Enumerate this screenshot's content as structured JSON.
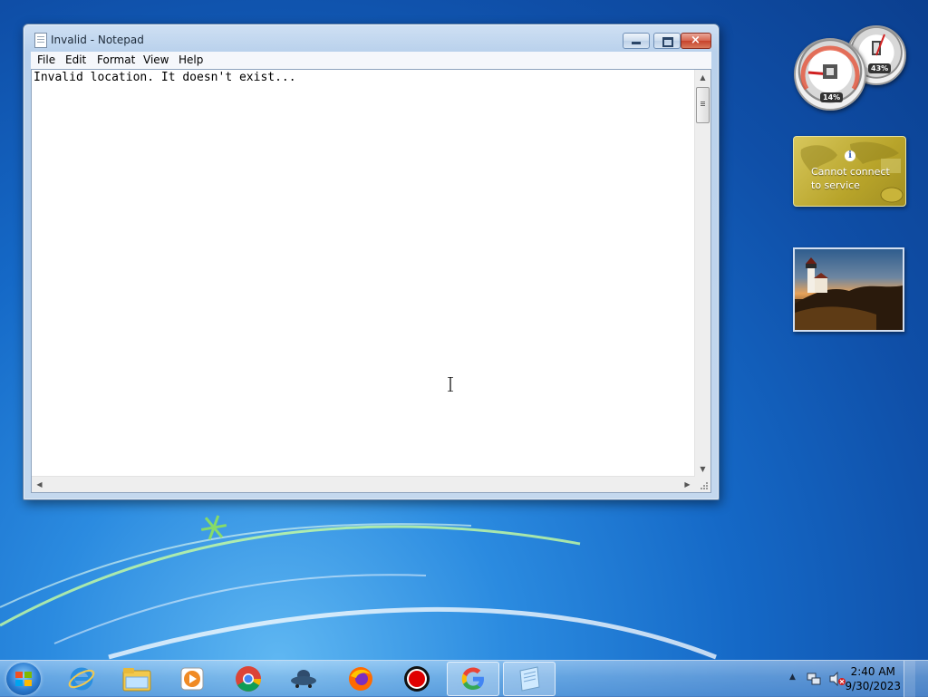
{
  "window": {
    "title": "Invalid - Notepad",
    "menu": [
      "File",
      "Edit",
      "Format",
      "View",
      "Help"
    ],
    "content": "Invalid location. It doesn't exist...",
    "controls": {
      "minimize": "minimize",
      "maximize": "maximize",
      "close": "×"
    }
  },
  "gadgets": {
    "cpu_meter": {
      "cpu": "14%",
      "memory": "43%"
    },
    "weather": {
      "message": "Cannot connect to service",
      "info_icon": "i"
    },
    "slideshow": {
      "subject": "lighthouse-at-sunset"
    }
  },
  "taskbar": {
    "start_icon": "windows-logo-icon",
    "items": [
      {
        "name": "Internet Explorer",
        "icon": "ie-icon",
        "color": "#2a8fe0"
      },
      {
        "name": "Windows Explorer",
        "icon": "folder-icon",
        "color": "#f2c94c"
      },
      {
        "name": "Windows Media Player",
        "icon": "media-player-icon",
        "color": "#f08a24"
      },
      {
        "name": "Google Chrome",
        "icon": "chrome-icon",
        "color": "#4285f4"
      },
      {
        "name": "App",
        "icon": "ufo-icon",
        "color": "#335577"
      },
      {
        "name": "Firefox",
        "icon": "firefox-icon",
        "color": "#ff6a00"
      },
      {
        "name": "Recorder",
        "icon": "record-icon",
        "color": "#e00000"
      },
      {
        "name": "Google",
        "icon": "google-icon",
        "color": "#4285f4"
      },
      {
        "name": "Notepad",
        "icon": "notepad-icon",
        "color": "#9ad0f0"
      }
    ],
    "clock": {
      "time": "2:40 AM",
      "date": "9/30/2023"
    }
  }
}
